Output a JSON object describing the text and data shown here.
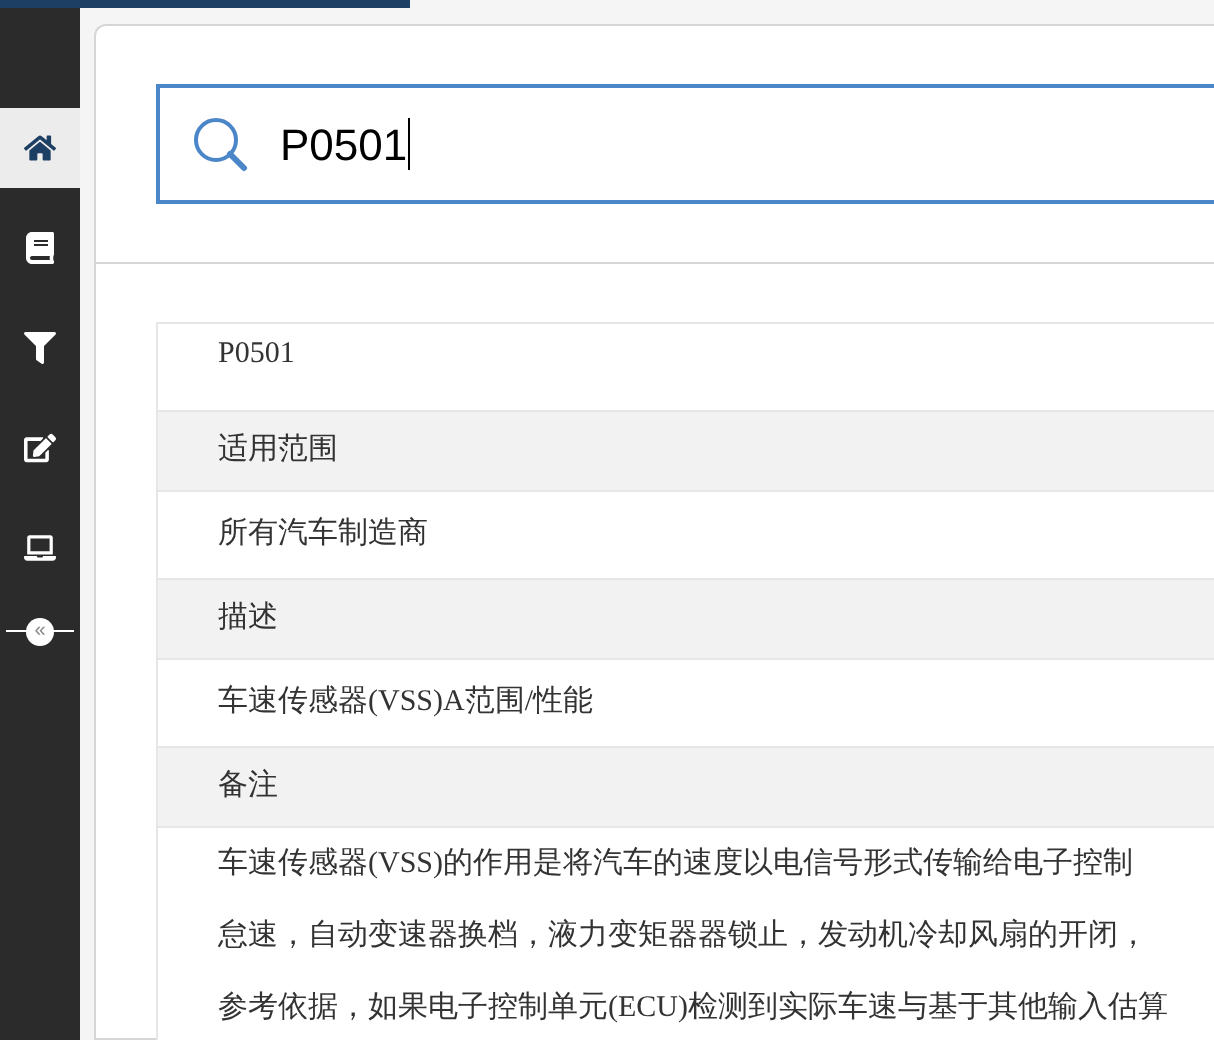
{
  "sidebar": {
    "items": [
      {
        "kind": "home",
        "selected": true
      },
      {
        "kind": "book",
        "selected": false
      },
      {
        "kind": "filter",
        "selected": false
      },
      {
        "kind": "edit",
        "selected": false
      },
      {
        "kind": "laptop",
        "selected": false
      }
    ],
    "collapse": {
      "label": "«"
    }
  },
  "search": {
    "value": "P0501"
  },
  "rows": [
    {
      "kind": "value",
      "text": "P0501"
    },
    {
      "kind": "header",
      "text": "适用范围"
    },
    {
      "kind": "value",
      "text": "所有汽车制造商"
    },
    {
      "kind": "header",
      "text": "描述"
    },
    {
      "kind": "value",
      "text": "车速传感器(VSS)A范围/性能"
    },
    {
      "kind": "header",
      "text": "备注"
    },
    {
      "kind": "paragraph",
      "lines": [
        "车速传感器(VSS)的作用是将汽车的速度以电信号形式传输给电子控制",
        "怠速，自动变速器换档，液力变矩器器锁止，发动机冷却风扇的开闭，",
        "参考依据，如果电子控制单元(ECU)检测到实际车速与基于其他输入估算"
      ]
    }
  ]
}
